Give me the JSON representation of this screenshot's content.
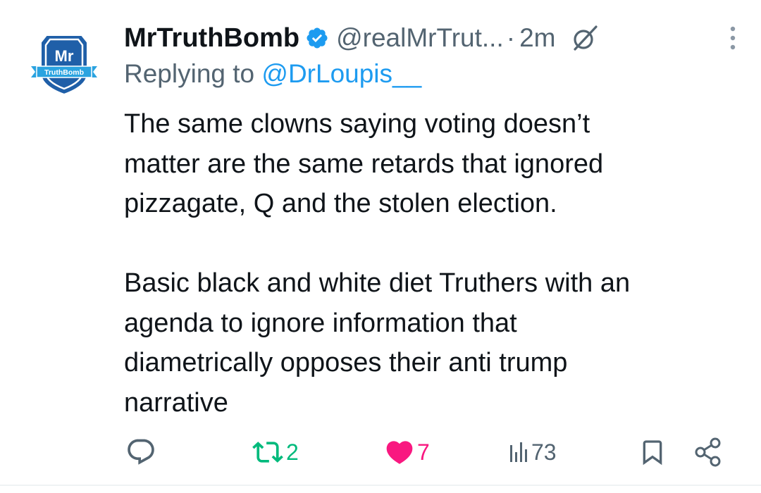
{
  "tweet": {
    "avatar": {
      "initials": "Mr",
      "banner": "TruthBomb",
      "colors": {
        "shield": "#1f5fa8",
        "banner": "#2aa3e0",
        "text": "#ffffff"
      }
    },
    "author": {
      "display_name": "MrTruthBomb",
      "verified": true,
      "handle": "@realMrTrut...",
      "separator": "·",
      "timestamp": "2m"
    },
    "reply": {
      "prefix": "Replying to",
      "mention": "@DrLoupis__"
    },
    "text": "The same clowns saying voting doesn’t\nmatter are the same retards that ignored\npizzagate, Q and the stolen election.\n\nBasic black and white diet Truthers with an\nagenda to ignore information that\ndiametrically opposes their anti trump\nnarrative",
    "actions": {
      "reply": {
        "icon": "reply-icon",
        "count": ""
      },
      "retweet": {
        "icon": "retweet-icon",
        "count": "2",
        "color": "#00ba7c"
      },
      "like": {
        "icon": "heart-icon",
        "count": "7",
        "color": "#f91880",
        "liked": true
      },
      "views": {
        "icon": "views-icon",
        "count": "73"
      },
      "bookmark": {
        "icon": "bookmark-icon"
      },
      "share": {
        "icon": "share-icon"
      }
    },
    "icons": {
      "verified": "verified-badge-icon",
      "grok": "grok-icon",
      "more": "more-dots-icon"
    },
    "colors": {
      "text": "#0f1419",
      "muted": "#536471",
      "link": "#1d9bf0",
      "verified": "#1d9bf0"
    }
  }
}
